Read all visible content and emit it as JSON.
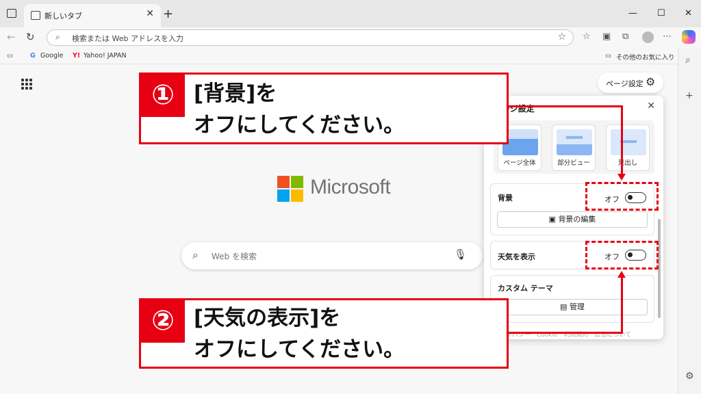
{
  "tab": {
    "title": "新しいタブ",
    "close": "✕",
    "new": "+"
  },
  "window": {
    "minimize": "—",
    "maximize": "☐",
    "close": "✕"
  },
  "address": {
    "placeholder": "検索または Web アドレスを入力"
  },
  "bookmarks": {
    "items": [
      {
        "icon": "G",
        "label": "Google"
      },
      {
        "icon": "Y!",
        "label": "Yahoo! JAPAN"
      }
    ],
    "other": "その他のお気に入り"
  },
  "main": {
    "brand": "Microsoft",
    "search_placeholder": "Web を検索",
    "page_settings": "ページ設定",
    "brand_colors": [
      "#f25022",
      "#7fba00",
      "#00a4ef",
      "#ffb900"
    ]
  },
  "panel": {
    "title": "ページ設定",
    "layouts": [
      "ページ全体",
      "部分ビュー",
      "見出し"
    ],
    "background": {
      "title": "背景",
      "state": "オフ",
      "edit": "背景の編集"
    },
    "weather": {
      "title": "天気を表示",
      "state": "オフ"
    },
    "theme": {
      "title": "カスタム テーマ",
      "manage": "管理"
    },
    "footer": "プライバシー　Cookie　利用規約　広告について"
  },
  "annotations": {
    "step1": {
      "num": "①",
      "line1": "[背景]を",
      "line2": "オフにしてください。"
    },
    "step2": {
      "num": "②",
      "line1": "[天気の表示]を",
      "line2": "オフにしてください。"
    },
    "accent": "#e60012"
  }
}
